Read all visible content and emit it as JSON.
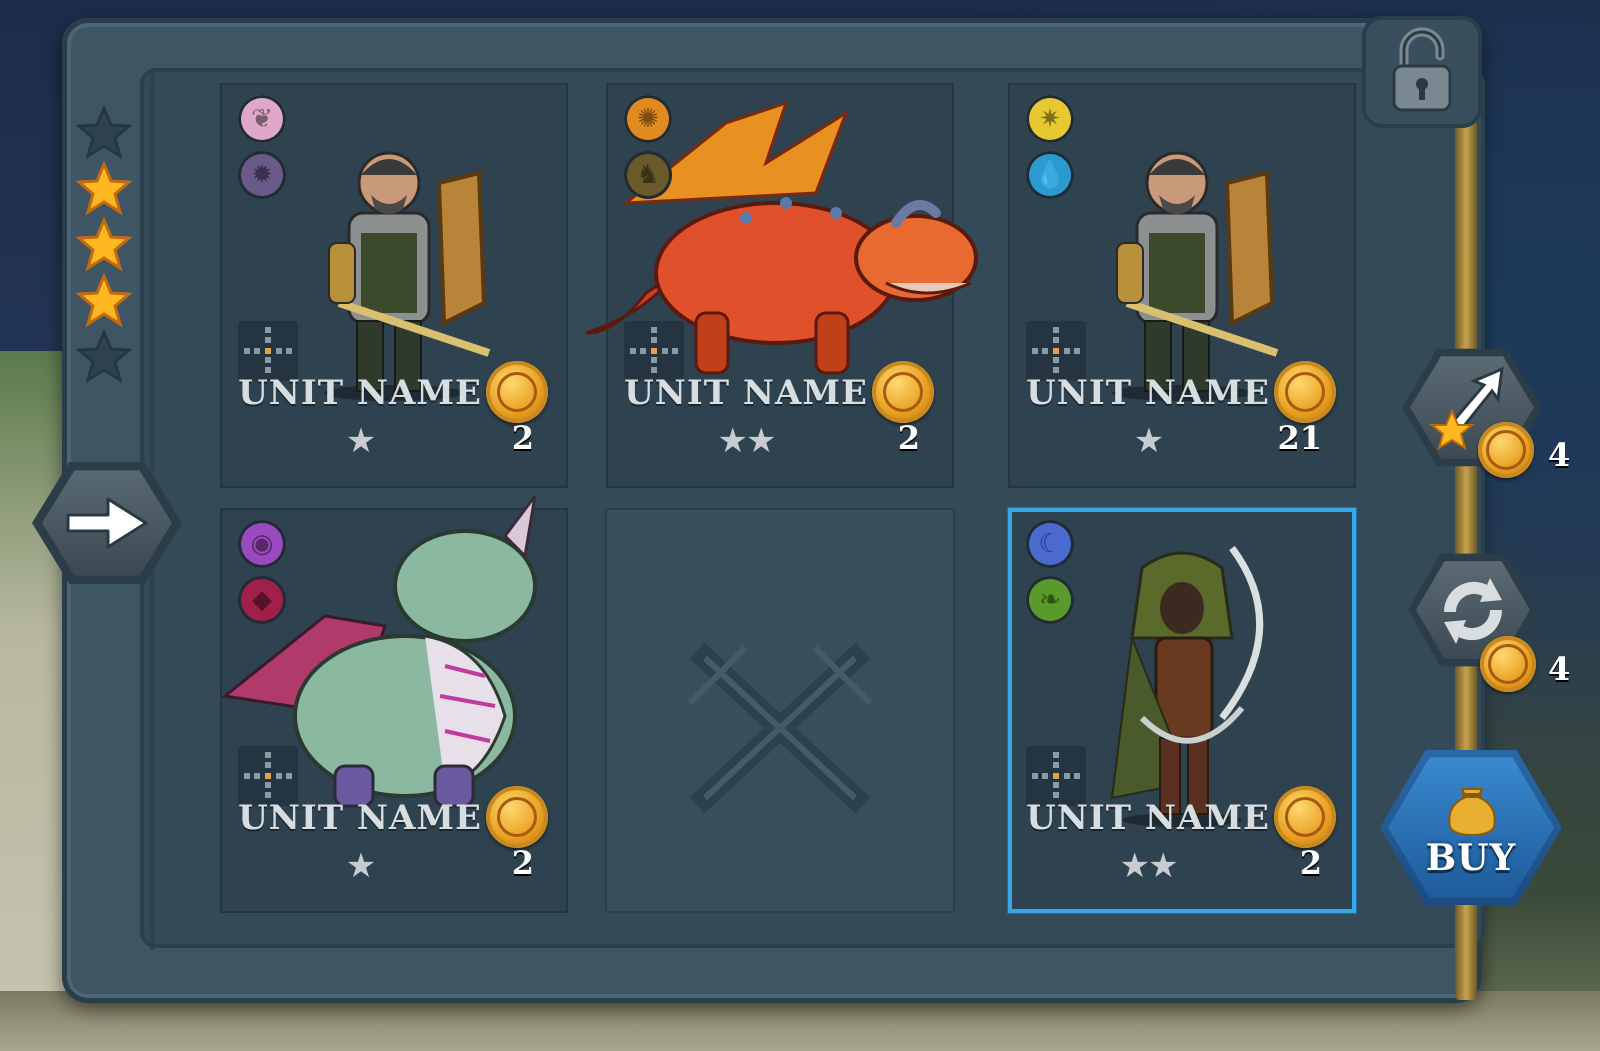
{
  "rating": {
    "filled": 3,
    "total": 5
  },
  "cards": [
    {
      "name": "UNIT NAME",
      "stars": "★",
      "cost": "2",
      "traits": [
        {
          "icon": "wings-icon",
          "color": "#e0a8c8"
        },
        {
          "icon": "gear-icon",
          "color": "#6a5a8a"
        }
      ],
      "art": "knight",
      "selected": false
    },
    {
      "name": "UNIT NAME",
      "stars": "★★",
      "cost": "2",
      "traits": [
        {
          "icon": "swirl-icon",
          "color": "#e08a20"
        },
        {
          "icon": "beast-icon",
          "color": "#6a5a2a"
        }
      ],
      "art": "fire-dragon",
      "selected": false
    },
    {
      "name": "UNIT NAME",
      "stars": "★",
      "cost": "21",
      "traits": [
        {
          "icon": "sun-icon",
          "color": "#e8c830"
        },
        {
          "icon": "water-drop-icon",
          "color": "#2a9ad0"
        }
      ],
      "art": "knight",
      "selected": false
    },
    {
      "name": "UNIT NAME",
      "stars": "★",
      "cost": "2",
      "traits": [
        {
          "icon": "eye-icon",
          "color": "#9a4ac0"
        },
        {
          "icon": "gem-icon",
          "color": "#a0204a"
        }
      ],
      "art": "green-dragon",
      "selected": false
    },
    null,
    {
      "name": "UNIT NAME",
      "stars": "★★",
      "cost": "2",
      "traits": [
        {
          "icon": "moon-icon",
          "color": "#4a6ad0"
        },
        {
          "icon": "leaf-icon",
          "color": "#5a9a2a"
        }
      ],
      "art": "rogue",
      "selected": true
    }
  ],
  "side": {
    "upgrade_cost": "4",
    "refresh_cost": "4",
    "buy_label": "BUY"
  },
  "colors": {
    "accent": "#36a8e6",
    "gold": "#e8a020"
  }
}
